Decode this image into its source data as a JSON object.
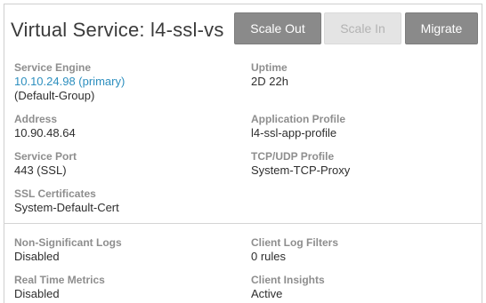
{
  "header": {
    "title": "Virtual Service: l4-ssl-vs",
    "buttons": {
      "scale_out": "Scale Out",
      "scale_in": "Scale In",
      "migrate": "Migrate"
    }
  },
  "details": {
    "service_engine": {
      "label": "Service Engine",
      "link": "10.10.24.98 (primary)",
      "group": "(Default-Group)"
    },
    "uptime": {
      "label": "Uptime",
      "value": "2D 22h"
    },
    "address": {
      "label": "Address",
      "value": "10.90.48.64"
    },
    "application_profile": {
      "label": "Application Profile",
      "value": "l4-ssl-app-profile"
    },
    "service_port": {
      "label": "Service Port",
      "value": "443 (SSL)"
    },
    "tcp_udp_profile": {
      "label": "TCP/UDP Profile",
      "value": "System-TCP-Proxy"
    },
    "ssl_certificates": {
      "label": "SSL Certificates",
      "value": "System-Default-Cert"
    }
  },
  "logging": {
    "non_significant_logs": {
      "label": "Non-Significant Logs",
      "value": "Disabled"
    },
    "client_log_filters": {
      "label": "Client Log Filters",
      "value": "0 rules"
    },
    "real_time_metrics": {
      "label": "Real Time Metrics",
      "value": "Disabled"
    },
    "client_insights": {
      "label": "Client Insights",
      "value": "Active"
    }
  },
  "colors": {
    "link": "#2d8fbf",
    "button_active": "#8a8a8a",
    "button_disabled": "#e4e4e4"
  }
}
